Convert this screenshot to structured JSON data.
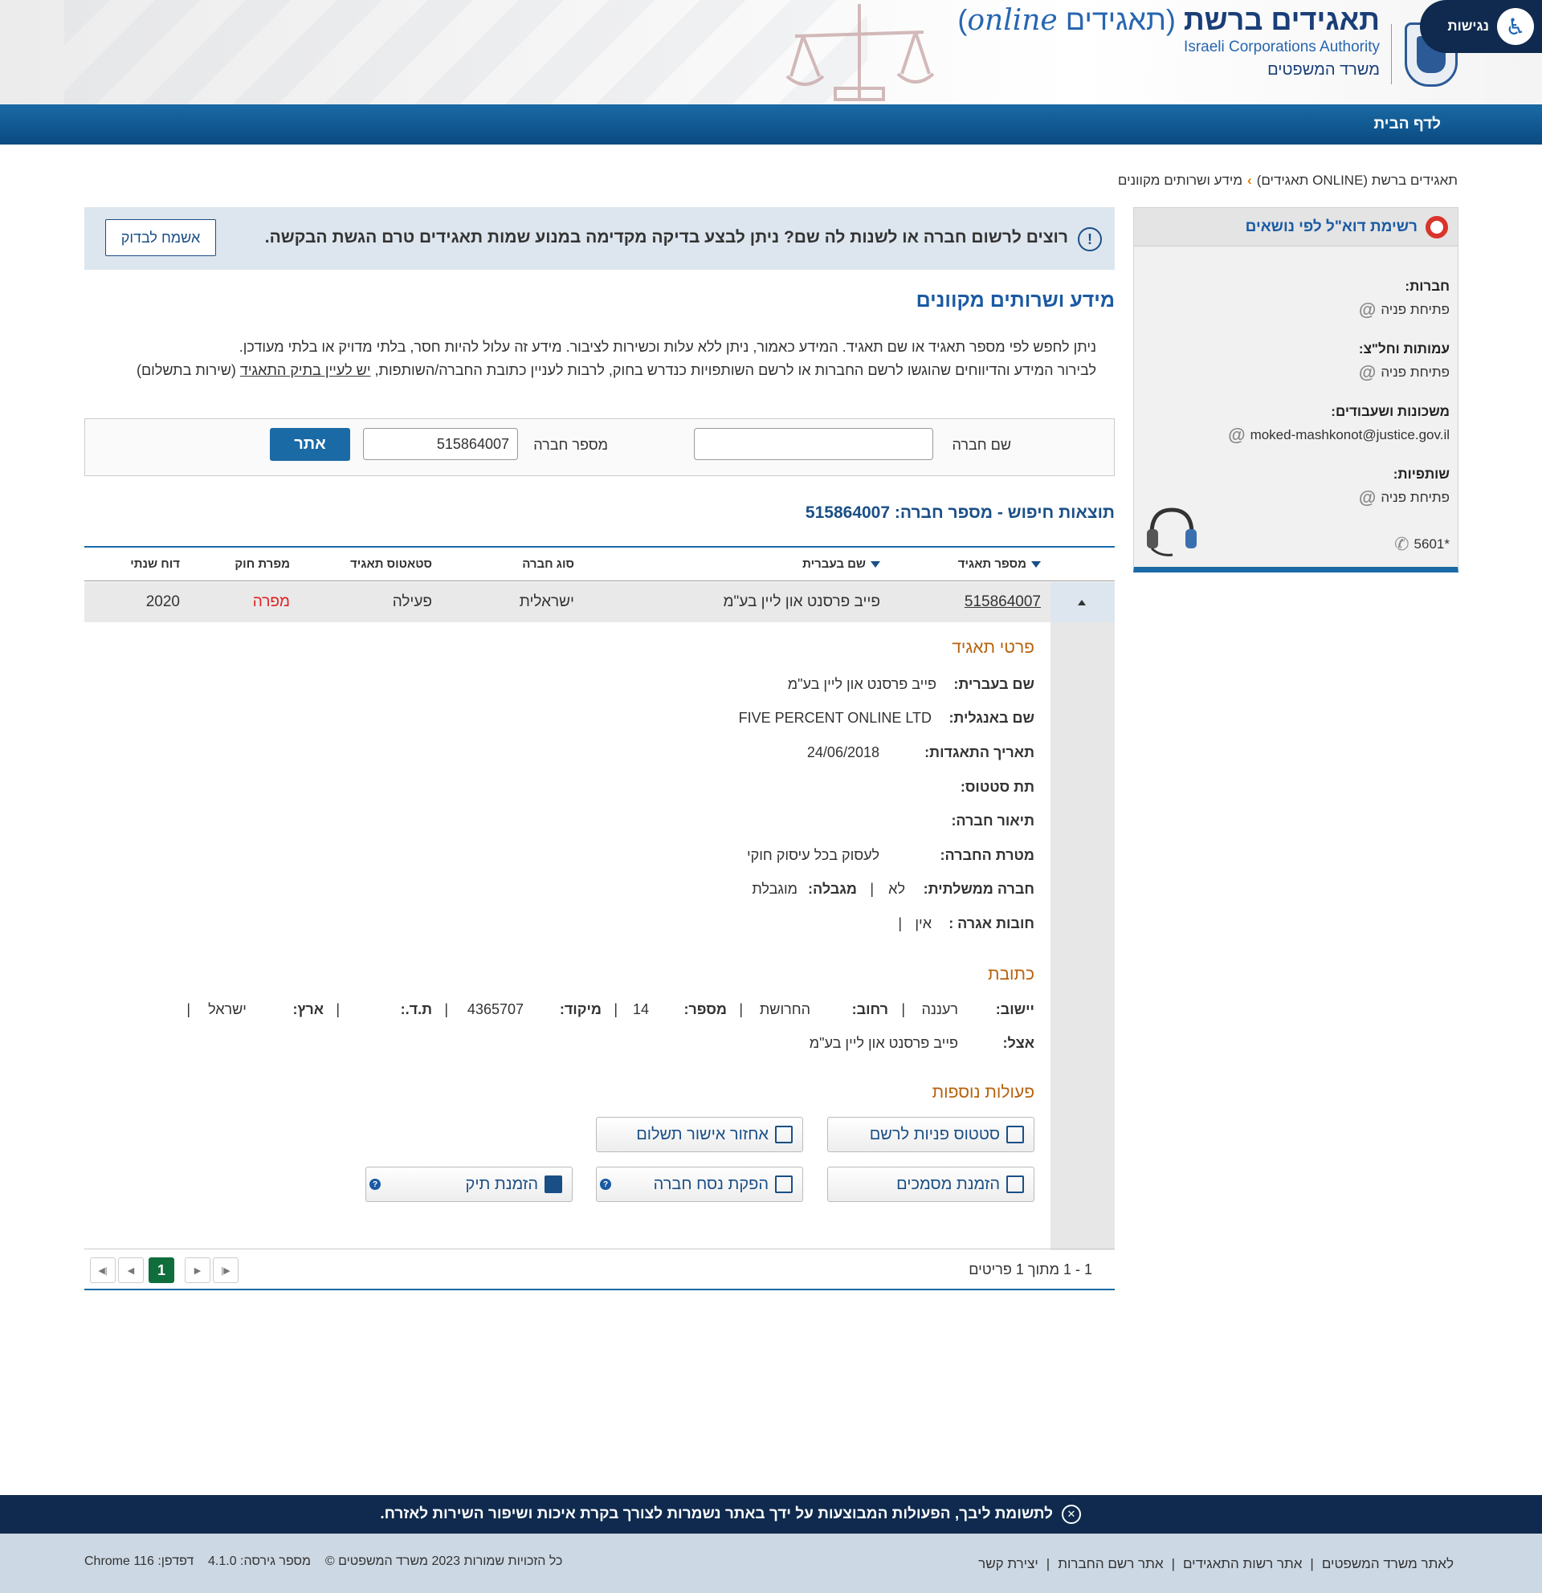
{
  "accessibility": {
    "label": "נגישות"
  },
  "site": {
    "title_main": "תאגידים ברשת",
    "title_paren_open": "(",
    "title_paren_word": "תאגידים",
    "title_online": "online",
    "subtitle_en": "Israeli Corporations Authority",
    "subtitle_he": "משרד המשפטים"
  },
  "nav": {
    "home": "לדף הבית"
  },
  "breadcrumb": {
    "parent": "תאגידים ברשת (ONLINE תאגידים)",
    "current": "מידע ושרותים מקוונים"
  },
  "sidebar": {
    "title": "רשימת דוא\"ל לפי נושאים",
    "groups": [
      {
        "title": "חברות:",
        "value": "פתיחת פניה"
      },
      {
        "title": "עמותות וחל\"צ:",
        "value": "פתיחת פניה"
      },
      {
        "title": "משכונות ושעבודים:",
        "value": "moked-mashkonot@justice.gov.il"
      },
      {
        "title": "שותפיות:",
        "value": "פתיחת פניה"
      }
    ],
    "phone": "*5601"
  },
  "notice": {
    "text": "רוצים לרשום חברה או לשנות לה שם? ניתן לבצע בדיקה מקדימה במנוע שמות תאגידים טרם הגשת הבקשה.",
    "button": "אשמח לבדוק"
  },
  "page": {
    "heading": "מידע ושרותים מקוונים",
    "intro_1": "ניתן לחפש לפי מספר תאגיד או שם תאגיד. המידע כאמור, ניתן ללא עלות וכשירות לציבור. מידע זה עלול להיות חסר, בלתי מדויק או בלתי מעודכן.",
    "intro_2a": "לבירור המידע והדיווחים שהוגשו לרשם החברות או לרשם השותפויות כנדרש בחוק, לרבות לעניין כתובת החברה/השותפות, ",
    "intro_link": "יש לעיין בתיק התאגיד",
    "intro_2b": " (שירות בתשלום)"
  },
  "search": {
    "name_label": "שם חברה",
    "name_value": "",
    "number_label": "מספר חברה",
    "number_value": "515864007",
    "button": "אתר"
  },
  "results": {
    "title": "תוצאות חיפוש - מספר חברה: 515864007"
  },
  "table": {
    "columns": [
      "מספר תאגיד",
      "שם בעברית",
      "סוג חברה",
      "סטאטוס תאגיד",
      "מפרת חוק",
      "דוח שנתי"
    ],
    "row": {
      "number": "515864007",
      "name_he": "פייב פרסנט און ליין בע\"מ",
      "type": "ישראלית",
      "status": "פעילה",
      "violator": "מפרה",
      "annual_report": "2020"
    },
    "violator_color": "#e02020"
  },
  "details": {
    "section_title": "פרטי תאגיד",
    "name_he_label": "שם בעברית:",
    "name_he": "פייב פרסנט און ליין בע\"מ",
    "name_en_label": "שם באנגלית:",
    "name_en": "FIVE PERCENT ONLINE LTD",
    "inc_date_label": "תאריך התאגדות:",
    "inc_date": "24/06/2018",
    "sub_status_label": "תת סטטוס:",
    "description_label": "תיאור חברה:",
    "purpose_label": "מטרת החברה:",
    "purpose": "לעסוק בכל עיסוק חוקי",
    "gov_label": "חברה ממשלתית:",
    "gov": "לא",
    "limited_label": "מגבלה:",
    "limited": "מוגבלת",
    "fee_label": "חובות אגרה :",
    "fee": "אין"
  },
  "address": {
    "section_title": "כתובת",
    "city_label": "יישוב:",
    "city": "רעננה",
    "street_label": "רחוב:",
    "street": "החרושת",
    "number_label": "מספר:",
    "number": "14",
    "zip_label": "מיקוד:",
    "zip": "4365707",
    "pobox_label": "ת.ד.:",
    "country_label": "ארץ:",
    "country": "ישראל",
    "care_of_label": "אצל:",
    "care_of": "פייב פרסנט און ליין בע\"מ"
  },
  "actions": {
    "section_title": "פעולות נוספות",
    "registrar_status": "סטטוס פניות לרשם",
    "payment_receipt": "אחזור אישור תשלום",
    "order_docs": "הזמנת מסמכים",
    "company_extract": "הפקת נסח חברה",
    "order_file": "הזמנת תיק"
  },
  "pager": {
    "summary": "1 - 1 מתוך 1 פריטים",
    "current_page": "1"
  },
  "cookie": {
    "text": "לתשומת ליבך, הפעולות המבוצעות על ידך באתר נשמרות לצורך בקרת איכות ושיפור השירות לאזרח."
  },
  "footer": {
    "links": [
      "לאתר משרד המשפטים",
      "אתר רשות התאגידים",
      "אתר רשם החברות",
      "יצירת קשר"
    ],
    "copyright": "כל הזכויות שמורות 2023 משרד המשפטים ©",
    "version_label": "מספר גירסה:",
    "version": "4.1.0",
    "browser_label": "דפדפן:",
    "browser": "Chrome 116"
  }
}
